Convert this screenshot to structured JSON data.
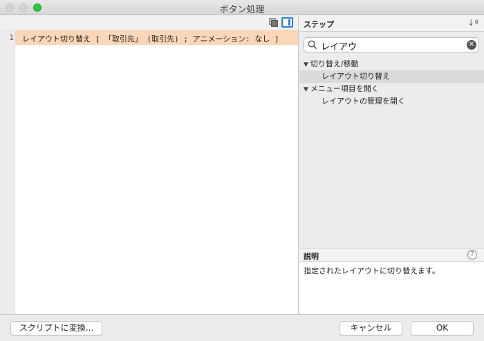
{
  "window": {
    "title": "ボタン処理"
  },
  "editor": {
    "line_number": "1",
    "code_line": "レイアウト切り替え [ 「取引先」 (取引先) ; アニメーション: なし ]"
  },
  "steps_panel": {
    "title": "ステップ",
    "sort_glyph": "↓ª",
    "search": {
      "value": "レイアウ"
    },
    "tree": [
      {
        "type": "category",
        "label": "切り替え/移動",
        "expanded": true
      },
      {
        "type": "item",
        "label": "レイアウト切り替え",
        "selected": true
      },
      {
        "type": "category",
        "label": "メニュー項目を開く",
        "expanded": true
      },
      {
        "type": "item",
        "label": "レイアウトの管理を開く",
        "selected": false
      }
    ]
  },
  "description": {
    "title": "説明",
    "text": "指定されたレイアウトに切り替えます。"
  },
  "buttons": {
    "convert": "スクリプトに変換...",
    "cancel": "キャンセル",
    "ok": "OK"
  },
  "icons": {
    "expand_glyph": "▼",
    "help_glyph": "?",
    "clear_glyph": "✕"
  },
  "colors": {
    "selected_line": "#fbd6b8",
    "accent": "#2a7de1",
    "zoom_button": "#2ec742"
  }
}
